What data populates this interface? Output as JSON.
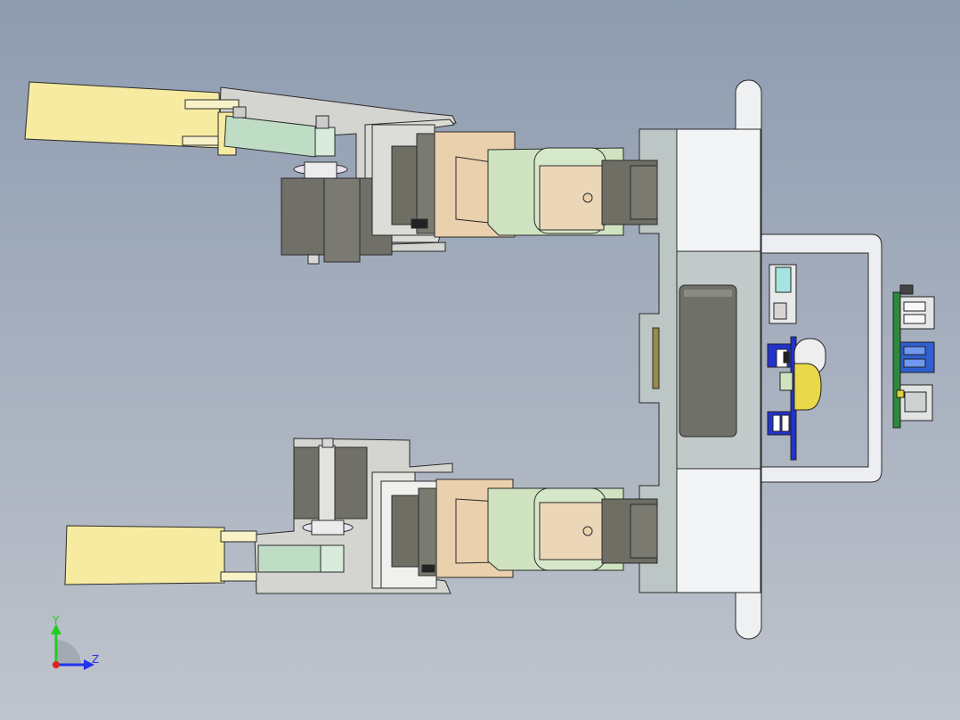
{
  "triad": {
    "y_label": "Y",
    "z_label": "Z",
    "colors": {
      "y": "#22cc22",
      "z": "#2233ee",
      "x": "#dd2222"
    }
  },
  "colors": {
    "background_top": "#8e9cb0",
    "background_bottom": "#bfc4cc",
    "gripper_finger": "#f6eba0",
    "link_tan": "#ead0ac",
    "link_green": "#cfe3c0",
    "servo_dark": "#6e6e64",
    "bracket_grey": "#cfd0cc",
    "base_plate": "#bcc6c4",
    "flange_white": "#eef0f2",
    "electronics_blue": "#2233cc",
    "pcb_green": "#2c8a3a",
    "ultrasonic_yellow": "#e8d84a"
  }
}
